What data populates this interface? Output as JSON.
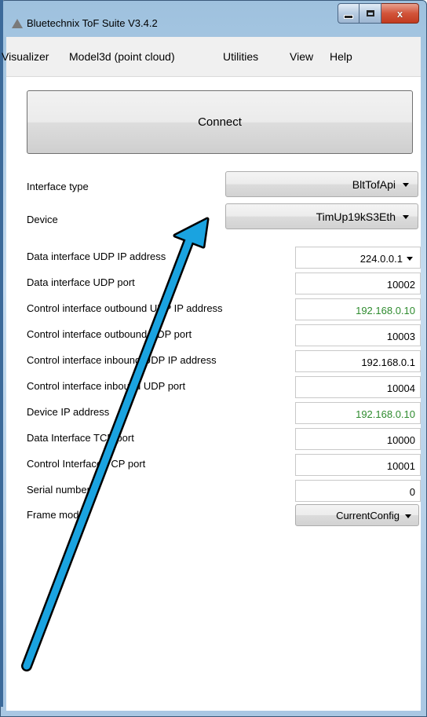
{
  "window": {
    "title": "Bluetechnix ToF Suite V3.4.2",
    "close_symbol": "x"
  },
  "menu": [
    "Visualizer",
    "Model3d (point cloud)",
    "Utilities",
    "View",
    "Help"
  ],
  "connect_label": "Connect",
  "interface_type": {
    "label": "Interface type",
    "value": "BltTofApi"
  },
  "device": {
    "label": "Device",
    "value": "TimUp19kS3Eth"
  },
  "params": [
    {
      "label": "Data interface UDP IP address",
      "value": "224.0.0.1"
    },
    {
      "label": "Data interface UDP port",
      "value": "10002"
    },
    {
      "label": "Control interface outbound UDP IP address",
      "value": "192.168.0.10"
    },
    {
      "label": "Control interface outbound UDP port",
      "value": "10003"
    },
    {
      "label": "Control interface inbound UDP IP address",
      "value": "192.168.0.1"
    },
    {
      "label": "Control interface inbound UDP port",
      "value": "10004"
    },
    {
      "label": "Device IP address",
      "value": "192.168.0.10"
    },
    {
      "label": "Data Interface TCP port",
      "value": "10000"
    },
    {
      "label": "Control Interface TCP port",
      "value": "10001"
    },
    {
      "label": "Serial number",
      "value": "0"
    },
    {
      "label": "Frame mode",
      "value": "CurrentConfig"
    }
  ],
  "colors": {
    "highlight_value": "#2e8b2e",
    "annotation_arrow": "#1aa3e0"
  }
}
